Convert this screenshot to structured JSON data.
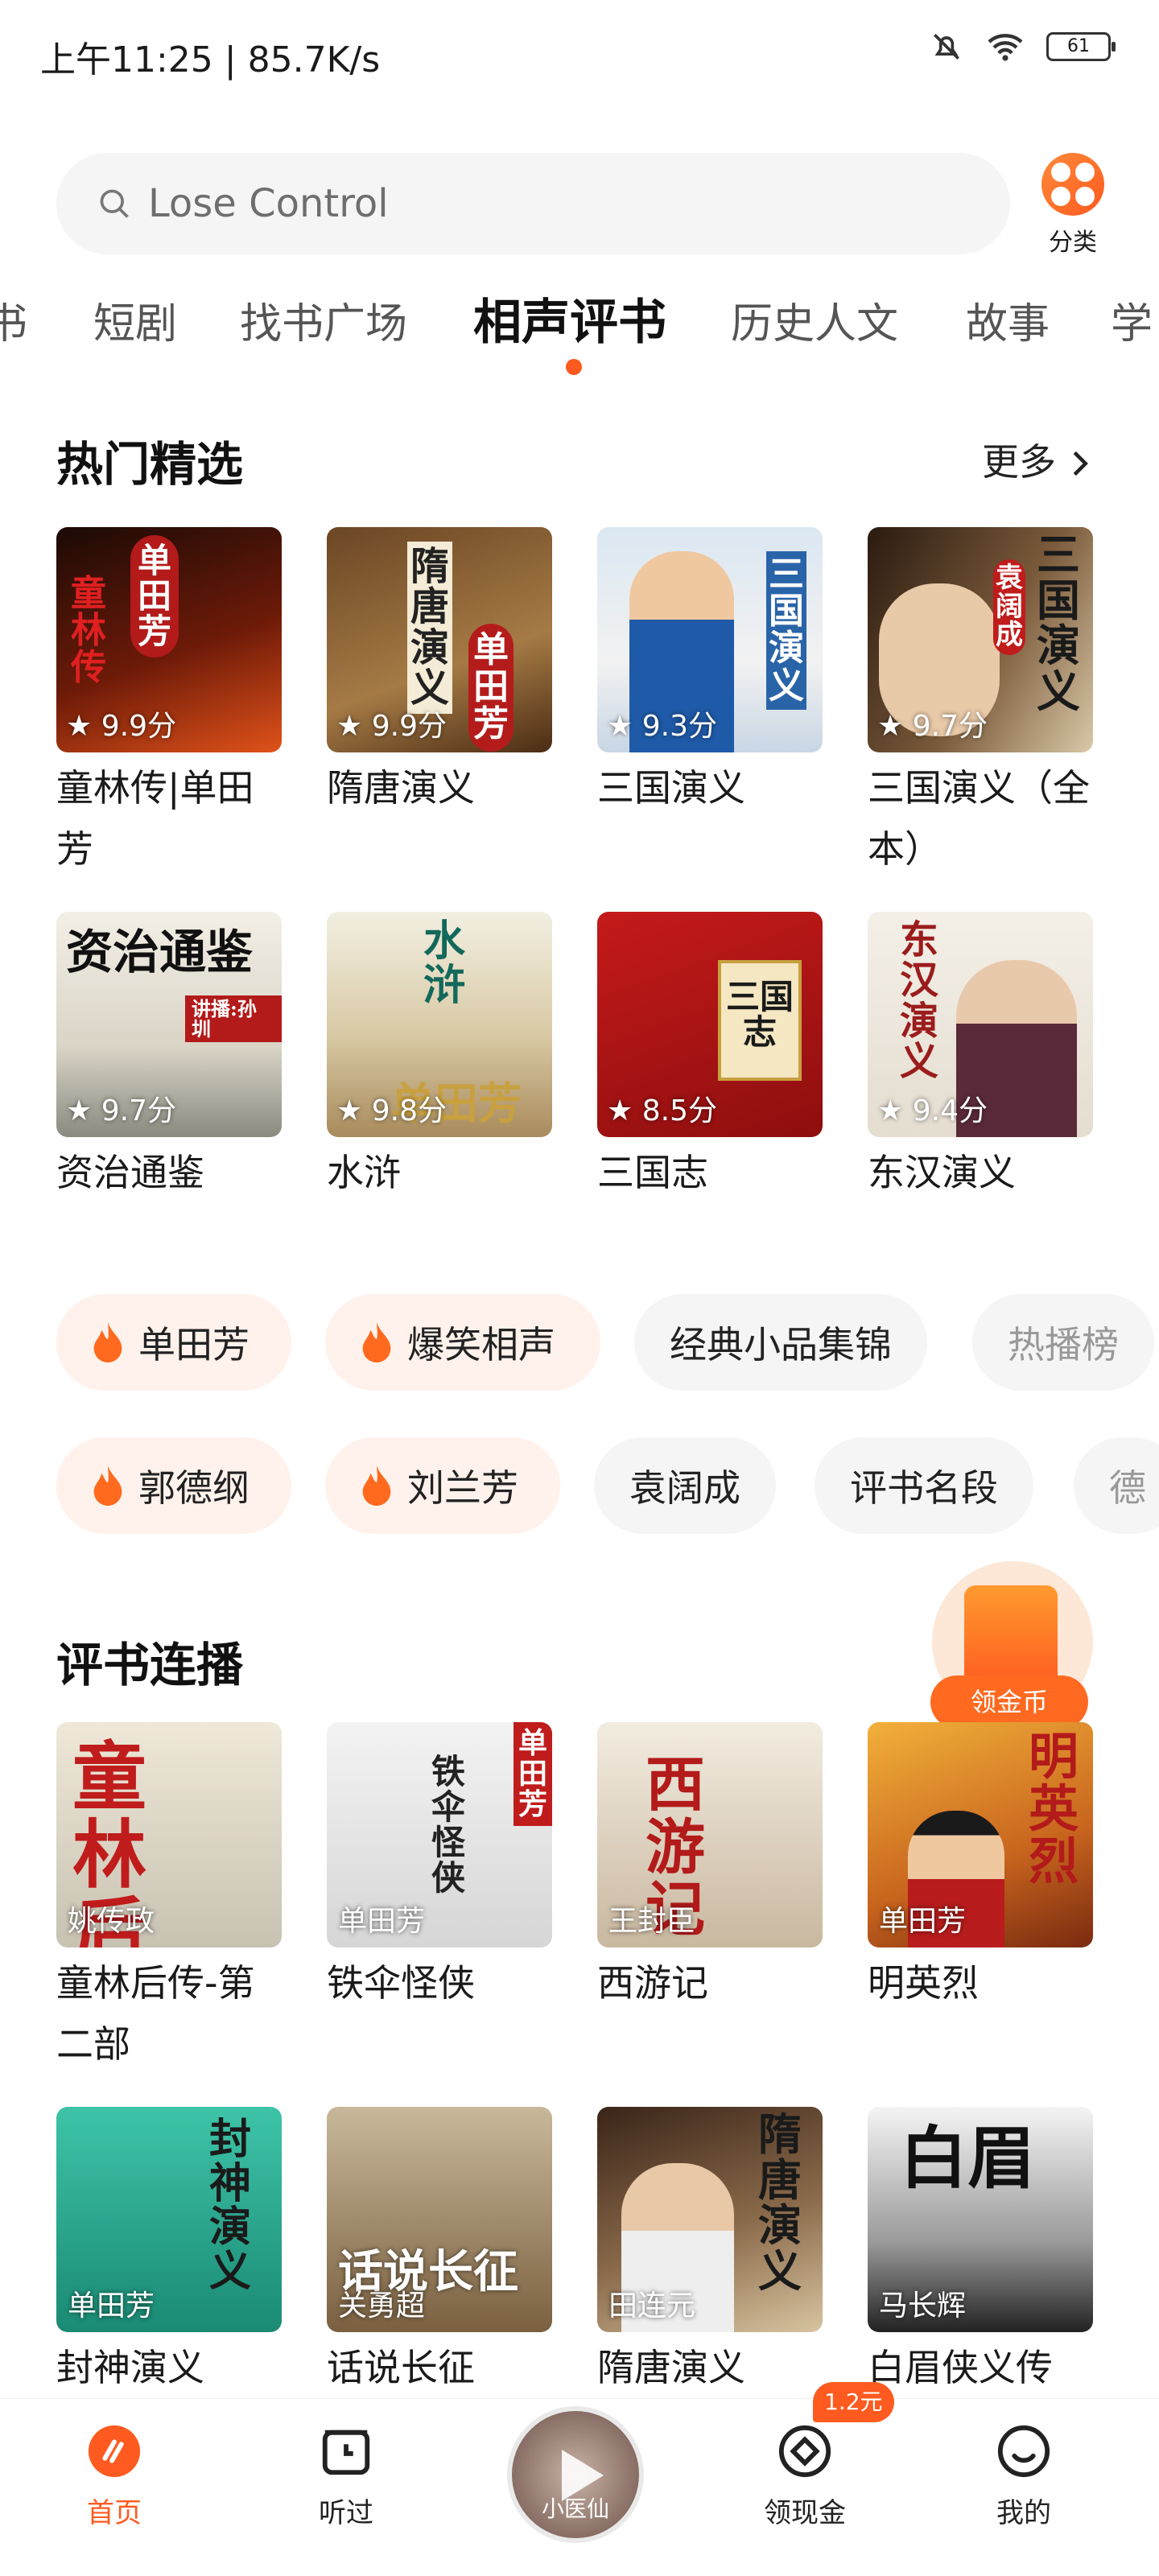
{
  "status_bar": {
    "time": "上午11:25 | 85.7K/s",
    "battery": "61"
  },
  "search": {
    "placeholder": "Lose Control"
  },
  "category": {
    "label": "分类"
  },
  "tabs": [
    "书",
    "短剧",
    "找书广场",
    "相声评书",
    "历史人文",
    "故事",
    "学"
  ],
  "active_tab": "相声评书",
  "hot_section": {
    "title": "热门精选",
    "more": "更多",
    "items": [
      {
        "title": "童林传|单田芳",
        "score": "9.9分",
        "cover_text": "单田芳",
        "cover_text2": "童林传"
      },
      {
        "title": "隋唐演义",
        "score": "9.9分",
        "cover_text": "隋唐演义",
        "cover_text2": "单田芳"
      },
      {
        "title": "三国演义",
        "score": "9.3分",
        "cover_text": "三国演义",
        "cover_text2": ""
      },
      {
        "title": "三国演义（全本）",
        "score": "9.7分",
        "cover_text": "三国演义",
        "cover_text2": "袁阔成"
      },
      {
        "title": "资治通鉴",
        "score": "9.7分",
        "cover_text": "资治通鉴",
        "cover_text2": "讲播:孙圳"
      },
      {
        "title": "水浒",
        "score": "9.8分",
        "cover_text": "水浒",
        "cover_text2": "单田芳"
      },
      {
        "title": "三国志",
        "score": "8.5分",
        "cover_text": "三国志",
        "cover_text2": ""
      },
      {
        "title": "东汉演义",
        "score": "9.4分",
        "cover_text": "东汉演义",
        "cover_text2": ""
      }
    ]
  },
  "chips_row1": [
    {
      "label": "单田芳",
      "hot": true
    },
    {
      "label": "爆笑相声",
      "hot": true
    },
    {
      "label": "经典小品集锦",
      "hot": false
    },
    {
      "label": "热播榜",
      "hot": false
    }
  ],
  "chips_row2": [
    {
      "label": "郭德纲",
      "hot": true
    },
    {
      "label": "刘兰芳",
      "hot": true
    },
    {
      "label": "袁阔成",
      "hot": false
    },
    {
      "label": "评书名段",
      "hot": false
    },
    {
      "label": "德",
      "hot": false
    }
  ],
  "coin_float": {
    "label": "领金币"
  },
  "serial_section": {
    "title": "评书连播",
    "items": [
      {
        "title": "童林后传-第二部",
        "author": "姚传政",
        "cover_text": "童林后传"
      },
      {
        "title": "铁伞怪侠",
        "author": "单田芳",
        "cover_text": "铁伞怪侠"
      },
      {
        "title": "西游记",
        "author": "王封臣",
        "cover_text": "西游记"
      },
      {
        "title": "明英烈",
        "author": "单田芳",
        "cover_text": "明英烈"
      },
      {
        "title": "封神演义",
        "author": "单田芳",
        "cover_text": "封神演义"
      },
      {
        "title": "话说长征",
        "author": "关勇超",
        "cover_text": "话说长征"
      },
      {
        "title": "隋唐演义",
        "author": "田连元",
        "cover_text": "隋唐演义"
      },
      {
        "title": "白眉侠义传",
        "author": "马长辉",
        "cover_text": "白眉"
      }
    ]
  },
  "bottom_nav": {
    "home": "首页",
    "history": "听过",
    "player": "小医仙",
    "coins": "领现金",
    "coins_badge": "1.2元",
    "me": "我的"
  },
  "colors": {
    "accent": "#ff5a1f"
  }
}
